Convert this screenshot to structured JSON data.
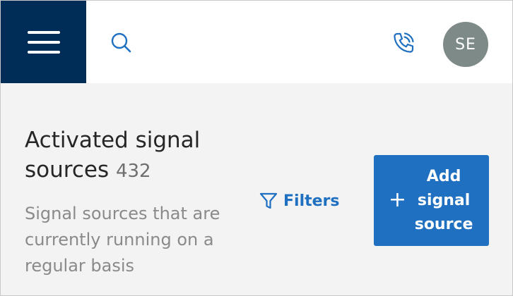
{
  "header": {
    "menu_icon": "hamburger-icon",
    "search_icon": "search-icon",
    "phone_icon": "phone-call-icon",
    "avatar_initials": "SE",
    "brand_color": "#002d57",
    "avatar_color": "#7e8a88"
  },
  "page": {
    "title": "Activated signal sources",
    "count": "432",
    "subtitle": "Signal sources that are currently running on a regular basis",
    "filters_label": "Filters",
    "filters_icon": "filter-icon",
    "add_button_label": "Add signal source",
    "add_icon": "plus-icon",
    "accent_color": "#1f70c1"
  }
}
